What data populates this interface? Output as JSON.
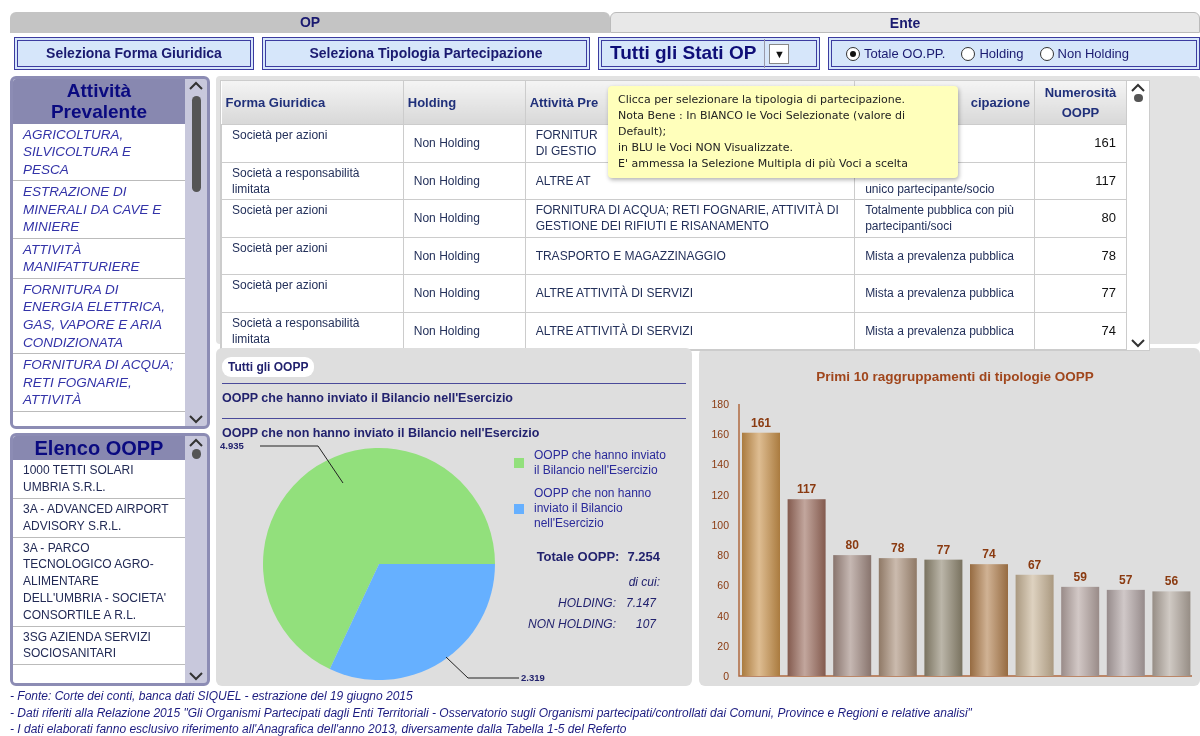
{
  "tabs": [
    {
      "label": "OP",
      "selected": true
    },
    {
      "label": "Ente",
      "selected": false
    }
  ],
  "filters": {
    "buttons": [
      "Seleziona Forma Giuridica",
      "Seleziona Tipologia Partecipazione"
    ],
    "dropdown": {
      "value": "Tutti gli Stati OP",
      "caret": "▼"
    },
    "radios": [
      {
        "label": "Totale OO.PP.",
        "selected": true
      },
      {
        "label": "Holding",
        "selected": false
      },
      {
        "label": "Non Holding",
        "selected": false
      }
    ]
  },
  "activity_list": {
    "title": "Attività Prevalente",
    "items": [
      "AGRICOLTURA, SILVICOLTURA E PESCA",
      "ESTRAZIONE DI MINERALI DA CAVE E MINIERE",
      "ATTIVITÀ MANIFATTURIERE",
      "FORNITURA DI ENERGIA ELETTRICA, GAS, VAPORE E ARIA CONDIZIONATA",
      "FORNITURA DI ACQUA; RETI FOGNARIE, ATTIVITÀ"
    ]
  },
  "entity_list": {
    "title": "Elenco OOPP",
    "items": [
      "1000 TETTI SOLARI UMBRIA S.R.L.",
      "3A - ADVANCED AIRPORT ADVISORY S.R.L.",
      "3A - PARCO TECNOLOGICO AGRO-ALIMENTARE DELL'UMBRIA - SOCIETA' CONSORTILE A R.L.",
      "3SG AZIENDA SERVIZI SOCIOSANITARI"
    ]
  },
  "table": {
    "columns": [
      "Forma Giuridica",
      "Holding",
      "Attività Pre",
      "cipazione",
      "Numerosità OOPP"
    ],
    "rows": [
      [
        "Società per azioni",
        "Non Holding",
        "FORNITUR\nDI GESTIO",
        null,
        "161"
      ],
      [
        "Società a responsabilità limitata",
        "Non Holding",
        "ALTRE AT",
        "unico partecipante/socio",
        "117"
      ],
      [
        "Società per azioni",
        "Non Holding",
        "FORNITURA DI ACQUA; RETI FOGNARIE, ATTIVITÀ DI GESTIONE DEI RIFIUTI E RISANAMENTO",
        "Totalmente pubblica con più partecipanti/soci",
        "80"
      ],
      [
        "Società per azioni",
        "Non Holding",
        "TRASPORTO E MAGAZZINAGGIO",
        "Mista a prevalenza pubblica",
        "78"
      ],
      [
        "Società per azioni",
        "Non Holding",
        "ALTRE ATTIVITÀ DI SERVIZI",
        "Mista a prevalenza pubblica",
        "77"
      ],
      [
        "Società a responsabilità limitata",
        "Non Holding",
        "ALTRE ATTIVITÀ DI SERVIZI",
        "Mista a prevalenza pubblica",
        "74"
      ]
    ]
  },
  "tooltip": [
    "Clicca per selezionare la tipologia di partecipazione.",
    "Nota Bene : In BIANCO le Voci Selezionate (valore di Default);",
    "in BLU le Voci NON Visualizzate.",
    "E' ammessa la Selezione Multipla di più Voci a scelta"
  ],
  "pie_panel": {
    "tag": "Tutti gli OOPP",
    "headings": [
      "OOPP che hanno inviato il Bilancio nell'Esercizio",
      "OOPP che non hanno inviato il Bilancio nell'Esercizio"
    ],
    "chart_data": {
      "type": "pie",
      "categories": [
        "OOPP che hanno inviato il Bilancio nell'Esercizio",
        "OOPP che non hanno inviato il Bilancio nell'Esercizio"
      ],
      "values": [
        4935,
        2319
      ],
      "colors": [
        "#92e07c",
        "#66b0ff"
      ],
      "value_labels": [
        "4.935",
        "2.319"
      ]
    },
    "total_label": "Totale OOPP:",
    "total": "7.254",
    "of_which": "di cui:",
    "breakdown": [
      {
        "label": "HOLDING:",
        "value": "7.147"
      },
      {
        "label": "NON HOLDING:",
        "value": "107"
      }
    ]
  },
  "bar_panel": {
    "chart_data": {
      "type": "bar",
      "title": "Primi 10 raggruppamenti di tipologie OOPP",
      "values": [
        161,
        117,
        80,
        78,
        77,
        74,
        67,
        59,
        57,
        56
      ],
      "colors": [
        "#c8914a",
        "#9a6a5c",
        "#a08880",
        "#a88e78",
        "#8e8670",
        "#b07e4c",
        "#c8b496",
        "#b4a4a0",
        "#b0a4a4",
        "#b0a69c"
      ],
      "ylim": [
        0,
        180
      ],
      "yticks": [
        0,
        20,
        40,
        60,
        80,
        100,
        120,
        140,
        160,
        180
      ],
      "data_labels": true
    }
  },
  "footer": [
    "- Fonte: Corte dei conti, banca dati SIQUEL - estrazione del 19 giugno 2015",
    "- Dati riferiti alla Relazione 2015 \"Gli Organismi Partecipati dagli Enti Territoriali - Osservatorio sugli Organismi partecipati/controllati dai Comuni, Province e Regioni e relative analisi\"",
    "- I dati elaborati fanno esclusivo riferimento all'Anagrafica dell'anno 2013, diversamente dalla Tabella 1-5 del Referto"
  ]
}
